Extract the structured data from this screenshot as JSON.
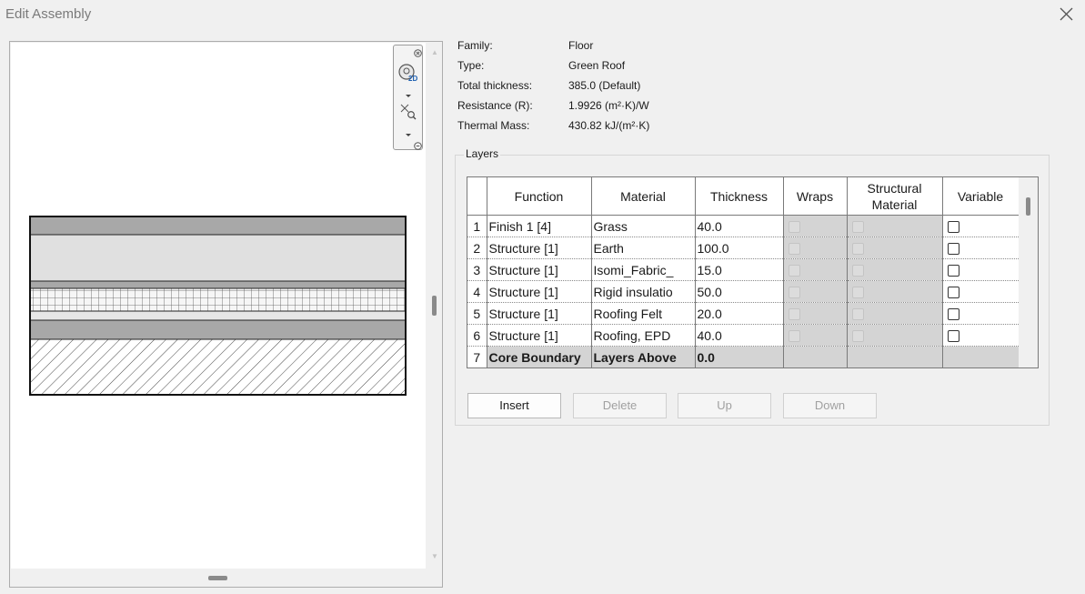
{
  "window": {
    "title": "Edit Assembly"
  },
  "properties": [
    {
      "label": "Family:",
      "value": "Floor"
    },
    {
      "label": "Type:",
      "value": "Green Roof"
    },
    {
      "label": "Total thickness:",
      "value": "385.0 (Default)"
    },
    {
      "label": "Resistance (R):",
      "value": "1.9926 (m²·K)/W"
    },
    {
      "label": "Thermal Mass:",
      "value": "430.82 kJ/(m²·K)"
    }
  ],
  "layers": {
    "caption": "Layers",
    "columns": {
      "function": "Function",
      "material": "Material",
      "thickness": "Thickness",
      "wraps": "Wraps",
      "structural_1": "Structural",
      "structural_2": "Material",
      "variable": "Variable"
    },
    "rows": [
      {
        "num": "1",
        "function": "Finish 1 [4]",
        "material": "Grass",
        "thickness": "40.0"
      },
      {
        "num": "2",
        "function": "Structure [1]",
        "material": "Earth",
        "thickness": "100.0"
      },
      {
        "num": "3",
        "function": "Structure [1]",
        "material": "Isomi_Fabric_",
        "thickness": "15.0"
      },
      {
        "num": "4",
        "function": "Structure [1]",
        "material": "Rigid insulatio",
        "thickness": "50.0"
      },
      {
        "num": "5",
        "function": "Structure [1]",
        "material": "Roofing Felt",
        "thickness": "20.0"
      },
      {
        "num": "6",
        "function": "Structure [1]",
        "material": "Roofing, EPD",
        "thickness": "40.0"
      },
      {
        "num": "7",
        "function": "Core Boundary",
        "material": "Layers Above",
        "thickness": "0.0"
      }
    ]
  },
  "buttons": {
    "insert": "Insert",
    "delete": "Delete",
    "up": "Up",
    "down": "Down"
  },
  "navbar": {
    "twod": "2D"
  }
}
